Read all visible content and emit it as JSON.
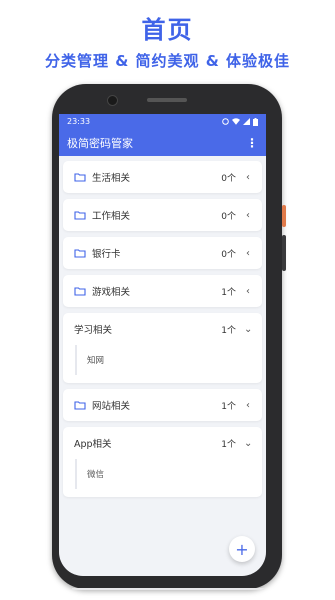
{
  "hero": {
    "title": "首页",
    "subtitle": "分类管理 & 简约美观 & 体验极佳"
  },
  "statusbar": {
    "time": "23:33"
  },
  "appbar": {
    "title": "极简密码管家",
    "menu_icon": "more-vert-icon"
  },
  "categories": [
    {
      "label": "生活相关",
      "count": "0个",
      "expanded": false,
      "icon": "folder-icon"
    },
    {
      "label": "工作相关",
      "count": "0个",
      "expanded": false,
      "icon": "folder-icon"
    },
    {
      "label": "银行卡",
      "count": "0个",
      "expanded": false,
      "icon": "folder-icon"
    },
    {
      "label": "游戏相关",
      "count": "1个",
      "expanded": false,
      "icon": "folder-icon"
    },
    {
      "label": "学习相关",
      "count": "1个",
      "expanded": true,
      "items": [
        "知网"
      ]
    },
    {
      "label": "网站相关",
      "count": "1个",
      "expanded": false,
      "icon": "folder-icon"
    },
    {
      "label": "App相关",
      "count": "1个",
      "expanded": true,
      "items": [
        "微信"
      ]
    }
  ],
  "fab": {
    "label": "+",
    "icon": "add-icon"
  },
  "colors": {
    "accent": "#3f63e8",
    "appbar": "#4a6ae8",
    "background": "#f1f3f7"
  }
}
